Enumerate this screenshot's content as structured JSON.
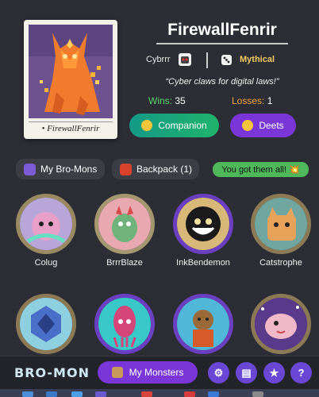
{
  "profile": {
    "card_name": "• FirewallFenrir",
    "username": "FirewallFenrir",
    "tribe": "Cybrrr",
    "rarity": "Mythical",
    "motto": "“Cyber claws for digital laws!”",
    "wins_label": "Wins:",
    "wins_value": "35",
    "losses_label": "Losses:",
    "losses_value": "1"
  },
  "actions": {
    "companion_label": "Companion",
    "deets_label": "Deets"
  },
  "tabs": {
    "my_bromons": "My Bro-Mons",
    "backpack": "Backpack (1)",
    "completion_badge": "You got them all! 💥"
  },
  "monsters": [
    {
      "name": "Colug"
    },
    {
      "name": "BrrrBlaze"
    },
    {
      "name": "InkBendemon"
    },
    {
      "name": "Catstrophe"
    },
    {
      "name": ""
    },
    {
      "name": ""
    },
    {
      "name": ""
    },
    {
      "name": ""
    }
  ],
  "bottom": {
    "logo": "BRO-MON",
    "my_monsters_label": "My Monsters",
    "settings_icon": "⚙",
    "chat_icon": "▤",
    "favorites_icon": "★",
    "help_icon": "?"
  },
  "colors": {
    "accent_purple": "#7a36d8",
    "wins_green": "#58d56b",
    "losses_orange": "#f5a53a",
    "rarity_gold": "#f3cc62",
    "badge_green": "#4fb85a"
  }
}
